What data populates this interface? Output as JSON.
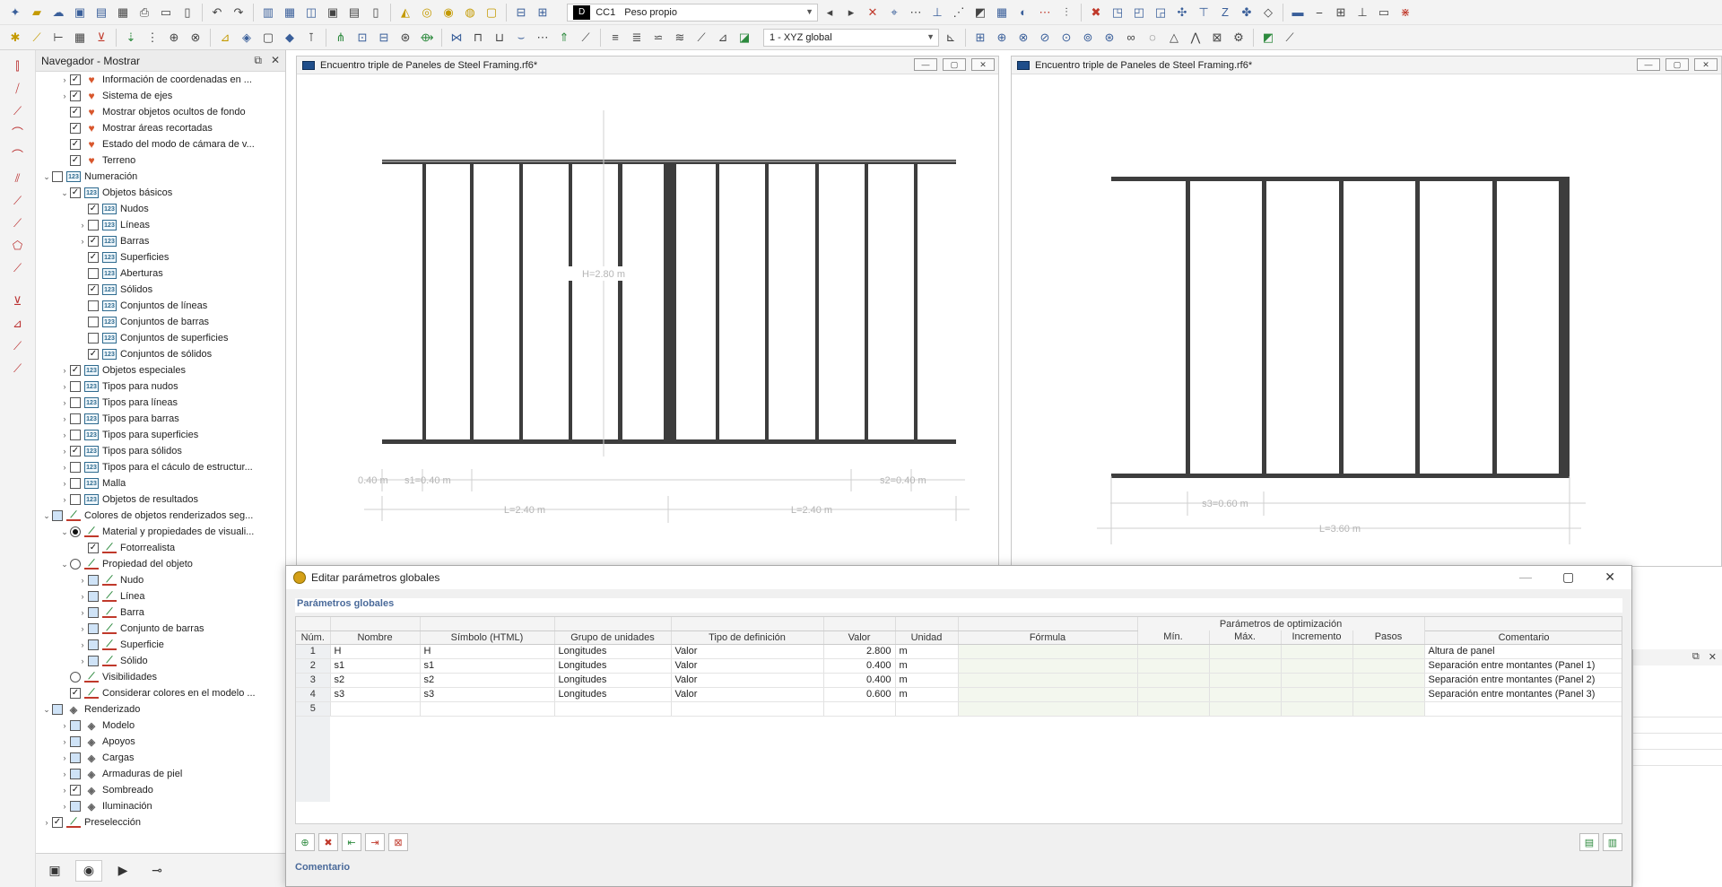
{
  "toolbar": {
    "load_case_code": "D",
    "load_case_id": "CC1",
    "load_case_name": "Peso propio",
    "coordinate_system": "1 - XYZ global"
  },
  "navigator": {
    "title": "Navegador - Mostrar",
    "items": [
      {
        "label": "Información de coordenadas en ...",
        "indent": 1,
        "exp": "›",
        "check": "on",
        "icon": "heart"
      },
      {
        "label": "Sistema de ejes",
        "indent": 1,
        "exp": "›",
        "check": "on",
        "icon": "heart"
      },
      {
        "label": "Mostrar objetos ocultos de fondo",
        "indent": 1,
        "exp": "",
        "check": "on",
        "icon": "heart"
      },
      {
        "label": "Mostrar áreas recortadas",
        "indent": 1,
        "exp": "",
        "check": "on",
        "icon": "heart"
      },
      {
        "label": "Estado del modo de cámara de v...",
        "indent": 1,
        "exp": "",
        "check": "on",
        "icon": "heart"
      },
      {
        "label": "Terreno",
        "indent": 1,
        "exp": "",
        "check": "on",
        "icon": "heart"
      },
      {
        "label": "Numeración",
        "indent": 0,
        "exp": "⌄",
        "check": "off",
        "icon": "num"
      },
      {
        "label": "Objetos básicos",
        "indent": 1,
        "exp": "⌄",
        "check": "on",
        "icon": "num"
      },
      {
        "label": "Nudos",
        "indent": 2,
        "exp": "",
        "check": "on",
        "icon": "num"
      },
      {
        "label": "Líneas",
        "indent": 2,
        "exp": "›",
        "check": "off",
        "icon": "num"
      },
      {
        "label": "Barras",
        "indent": 2,
        "exp": "›",
        "check": "on",
        "icon": "num"
      },
      {
        "label": "Superficies",
        "indent": 2,
        "exp": "",
        "check": "on",
        "icon": "num"
      },
      {
        "label": "Aberturas",
        "indent": 2,
        "exp": "",
        "check": "off",
        "icon": "num"
      },
      {
        "label": "Sólidos",
        "indent": 2,
        "exp": "",
        "check": "on",
        "icon": "num"
      },
      {
        "label": "Conjuntos de líneas",
        "indent": 2,
        "exp": "",
        "check": "off",
        "icon": "num"
      },
      {
        "label": "Conjuntos de barras",
        "indent": 2,
        "exp": "",
        "check": "off",
        "icon": "num"
      },
      {
        "label": "Conjuntos de superficies",
        "indent": 2,
        "exp": "",
        "check": "off",
        "icon": "num"
      },
      {
        "label": "Conjuntos de sólidos",
        "indent": 2,
        "exp": "",
        "check": "on",
        "icon": "num"
      },
      {
        "label": "Objetos especiales",
        "indent": 1,
        "exp": "›",
        "check": "on",
        "icon": "num"
      },
      {
        "label": "Tipos para nudos",
        "indent": 1,
        "exp": "›",
        "check": "off",
        "icon": "num"
      },
      {
        "label": "Tipos para líneas",
        "indent": 1,
        "exp": "›",
        "check": "off",
        "icon": "num"
      },
      {
        "label": "Tipos para barras",
        "indent": 1,
        "exp": "›",
        "check": "off",
        "icon": "num"
      },
      {
        "label": "Tipos para superficies",
        "indent": 1,
        "exp": "›",
        "check": "off",
        "icon": "num"
      },
      {
        "label": "Tipos para sólidos",
        "indent": 1,
        "exp": "›",
        "check": "on",
        "icon": "num"
      },
      {
        "label": "Tipos para el cáculo de estructur...",
        "indent": 1,
        "exp": "›",
        "check": "off",
        "icon": "num"
      },
      {
        "label": "Malla",
        "indent": 1,
        "exp": "›",
        "check": "off",
        "icon": "num"
      },
      {
        "label": "Objetos de resultados",
        "indent": 1,
        "exp": "›",
        "check": "off",
        "icon": "num"
      },
      {
        "label": "Colores de objetos renderizados seg...",
        "indent": 0,
        "exp": "⌄",
        "check": "blue",
        "icon": "col"
      },
      {
        "label": "Material y propiedades de visuali...",
        "indent": 1,
        "exp": "⌄",
        "check": "radio-on",
        "icon": "col"
      },
      {
        "label": "Fotorrealista",
        "indent": 2,
        "exp": "",
        "check": "on",
        "icon": "col"
      },
      {
        "label": "Propiedad del objeto",
        "indent": 1,
        "exp": "⌄",
        "check": "radio",
        "icon": "col"
      },
      {
        "label": "Nudo",
        "indent": 2,
        "exp": "›",
        "check": "blue",
        "icon": "col"
      },
      {
        "label": "Línea",
        "indent": 2,
        "exp": "›",
        "check": "blue",
        "icon": "col"
      },
      {
        "label": "Barra",
        "indent": 2,
        "exp": "›",
        "check": "blue",
        "icon": "col"
      },
      {
        "label": "Conjunto de barras",
        "indent": 2,
        "exp": "›",
        "check": "blue",
        "icon": "col"
      },
      {
        "label": "Superficie",
        "indent": 2,
        "exp": "›",
        "check": "blue",
        "icon": "col"
      },
      {
        "label": "Sólido",
        "indent": 2,
        "exp": "›",
        "check": "blue",
        "icon": "col"
      },
      {
        "label": "Visibilidades",
        "indent": 1,
        "exp": "",
        "check": "radio",
        "icon": "col"
      },
      {
        "label": "Considerar colores en el modelo ...",
        "indent": 1,
        "exp": "",
        "check": "on",
        "icon": "col"
      },
      {
        "label": "Renderizado",
        "indent": 0,
        "exp": "⌄",
        "check": "blue",
        "icon": "ren"
      },
      {
        "label": "Modelo",
        "indent": 1,
        "exp": "›",
        "check": "blue",
        "icon": "ren"
      },
      {
        "label": "Apoyos",
        "indent": 1,
        "exp": "›",
        "check": "blue",
        "icon": "ren"
      },
      {
        "label": "Cargas",
        "indent": 1,
        "exp": "›",
        "check": "blue",
        "icon": "ren"
      },
      {
        "label": "Armaduras de piel",
        "indent": 1,
        "exp": "›",
        "check": "blue",
        "icon": "ren"
      },
      {
        "label": "Sombreado",
        "indent": 1,
        "exp": "›",
        "check": "on",
        "icon": "ren"
      },
      {
        "label": "Iluminación",
        "indent": 1,
        "exp": "›",
        "check": "blue",
        "icon": "ren"
      },
      {
        "label": "Preselección",
        "indent": 0,
        "exp": "›",
        "check": "on",
        "icon": "col"
      }
    ]
  },
  "view_left": {
    "title": "Encuentro triple de Paneles de Steel Framing.rf6*",
    "dims": {
      "h": "H=2.80 m",
      "s1a": "0.40 m",
      "s1": "s1=0.40 m",
      "s2": "s2=0.40 m",
      "l1": "L=2.40 m",
      "l2": "L=2.40 m"
    }
  },
  "view_right": {
    "title": "Encuentro triple de Paneles de Steel Framing.rf6*",
    "dims": {
      "s3": "s3=0.60 m",
      "l": "L=3.60 m"
    }
  },
  "dialog": {
    "title": "Editar parámetros globales",
    "panel_title": "Parámetros globales",
    "group_header": "Parámetros de optimización",
    "columns": [
      "Núm.",
      "Nombre",
      "Símbolo (HTML)",
      "Grupo de unidades",
      "Tipo de definición",
      "Valor",
      "Unidad",
      "Fórmula",
      "Mín.",
      "Máx.",
      "Incremento",
      "Pasos",
      "Comentario"
    ],
    "rows": [
      {
        "num": "1",
        "name": "H",
        "symbol": "H",
        "group": "Longitudes",
        "def": "Valor",
        "value": "2.800",
        "unit": "m",
        "formula": "",
        "min": "",
        "max": "",
        "inc": "",
        "steps": "",
        "comment": "Altura de panel"
      },
      {
        "num": "2",
        "name": "s1",
        "symbol": "s1",
        "group": "Longitudes",
        "def": "Valor",
        "value": "0.400",
        "unit": "m",
        "formula": "",
        "min": "",
        "max": "",
        "inc": "",
        "steps": "",
        "comment": "Separación entre montantes (Panel 1)"
      },
      {
        "num": "3",
        "name": "s2",
        "symbol": "s2",
        "group": "Longitudes",
        "def": "Valor",
        "value": "0.400",
        "unit": "m",
        "formula": "",
        "min": "",
        "max": "",
        "inc": "",
        "steps": "",
        "comment": "Separación entre montantes (Panel 2)"
      },
      {
        "num": "4",
        "name": "s3",
        "symbol": "s3",
        "group": "Longitudes",
        "def": "Valor",
        "value": "0.600",
        "unit": "m",
        "formula": "",
        "min": "",
        "max": "",
        "inc": "",
        "steps": "",
        "comment": "Separación entre montantes (Panel 3)"
      },
      {
        "num": "5",
        "name": "",
        "symbol": "",
        "group": "",
        "def": "",
        "value": "",
        "unit": "",
        "formula": "",
        "min": "",
        "max": "",
        "inc": "",
        "steps": "",
        "comment": ""
      }
    ],
    "comment_label": "Comentario"
  },
  "colors": {
    "frame": "#3d3d3d",
    "dim": "#b8b8b8",
    "accent": "#4a6a9a"
  }
}
